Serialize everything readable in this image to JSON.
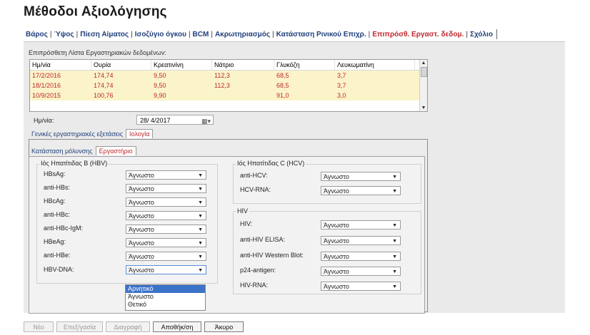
{
  "page_title": "Μέθοδοι Αξιολόγησης",
  "tabs": [
    {
      "label": "Βάρος",
      "active": false
    },
    {
      "label": "Ύψος",
      "active": false
    },
    {
      "label": "Πίεση Αίματος",
      "active": false
    },
    {
      "label": "Ισοζύγιο όγκου",
      "active": false
    },
    {
      "label": "BCM",
      "active": false
    },
    {
      "label": "Ακρωτηριασμός",
      "active": false
    },
    {
      "label": "Κατάσταση Ρινικού Επιχρ.",
      "active": false
    },
    {
      "label": "Επιπρόσθ. Εργαστ. δεδομ.",
      "active": true
    },
    {
      "label": "Σχόλιο",
      "active": false
    }
  ],
  "lab_list": {
    "label": "Επιπρόσθετη Λίστα Εργαστηριακών δεδομένων:",
    "columns": [
      "Ημ/νία",
      "Ουρία",
      "Κρεατινίνη",
      "Νάτριο",
      "Γλυκόζη",
      "Λευκωματίνη"
    ],
    "rows": [
      [
        "17/2/2016",
        "174,74",
        "9,50",
        "112,3",
        "68,5",
        "3,7"
      ],
      [
        "18/1/2016",
        "174,74",
        "9,50",
        "112,3",
        "68,5",
        "3,7"
      ],
      [
        "10/9/2015",
        "100,76",
        "9,90",
        "",
        "91,0",
        "3,0"
      ]
    ]
  },
  "date": {
    "label": "Ημ/νία:",
    "value": "28/ 4/2017",
    "calendar_icon": "calendar-icon"
  },
  "subtabs_level1": [
    {
      "label": "Γενικές εργαστηριακές εξετάσεις",
      "active": false
    },
    {
      "label": "Ιολογία",
      "active": true
    }
  ],
  "subtabs_level2": [
    {
      "label": "Κατάσταση μόλυνσης",
      "active": false
    },
    {
      "label": "Εργαστήριο",
      "active": true
    }
  ],
  "hbv": {
    "title": "Ιός Ηπατίτιδας Β (HBV)",
    "fields": [
      {
        "label": "HBsAg:",
        "value": "Άγνωστο"
      },
      {
        "label": "anti-HBs:",
        "value": "Άγνωστο"
      },
      {
        "label": "HBcAg:",
        "value": "Άγνωστο"
      },
      {
        "label": "anti-HBc:",
        "value": "Άγνωστο"
      },
      {
        "label": "anti-HBc-IgM:",
        "value": "Άγνωστο"
      },
      {
        "label": "HBeAg:",
        "value": "Άγνωστο"
      },
      {
        "label": "anti-HBe:",
        "value": "Άγνωστο"
      },
      {
        "label": "HBV-DNA:",
        "value": "Άγνωστο"
      }
    ]
  },
  "hcv": {
    "title": "Ιός Ηπατίτιδας C (HCV)",
    "fields": [
      {
        "label": "anti-HCV:",
        "value": "Άγνωστο"
      },
      {
        "label": "HCV-RNA:",
        "value": "Άγνωστο"
      }
    ]
  },
  "hiv": {
    "title": "HIV",
    "fields": [
      {
        "label": "HIV:",
        "value": "Άγνωστο"
      },
      {
        "label": "anti-HIV ELISA:",
        "value": "Άγνωστο"
      },
      {
        "label": "anti-HIV Western Blot:",
        "value": "Άγνωστο"
      },
      {
        "label": "p24-antigen:",
        "value": "Άγνωστο"
      },
      {
        "label": "HIV-RNA:",
        "value": "Άγνωστο"
      }
    ]
  },
  "dropdown_options": [
    {
      "label": "Αρνητικό",
      "selected": true
    },
    {
      "label": "Άγνωστο",
      "selected": false
    },
    {
      "label": "Θετικό",
      "selected": false
    }
  ],
  "buttons": {
    "new": "Νέο",
    "edit": "Επεξ/γασία",
    "delete": "Διαγραφή",
    "save": "Αποθήκ/ση",
    "cancel": "Άκυρο"
  },
  "colors": {
    "accent": "#c0282e",
    "tab_text": "#1f3f7a",
    "row_highlight": "#fbf4c8",
    "selection": "#3b73c9"
  }
}
